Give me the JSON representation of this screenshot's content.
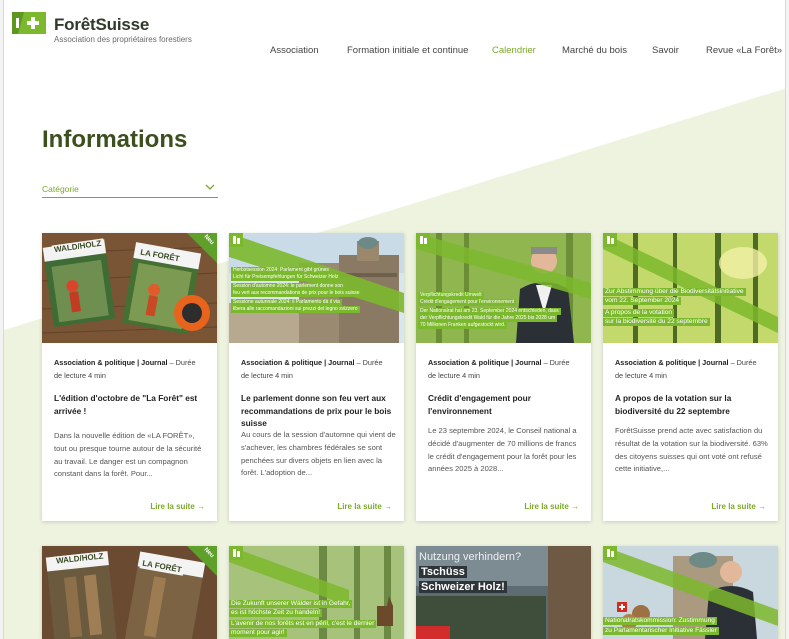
{
  "brand": {
    "name": "ForêtSuisse",
    "tagline": "Association des propriétaires forestiers"
  },
  "nav": [
    {
      "label": "Association",
      "active": false
    },
    {
      "label": "Formation initiale et continue",
      "active": false
    },
    {
      "label": "Calendrier",
      "active": true
    },
    {
      "label": "Marché du bois",
      "active": false
    },
    {
      "label": "Savoir",
      "active": false
    },
    {
      "label": "Revue «La Forêt»",
      "active": false
    }
  ],
  "page_title": "Informations",
  "filter": {
    "label": "Catégorie"
  },
  "colors": {
    "accent": "#7ba928",
    "title": "#3d4f1e",
    "wedge": "#eef3df"
  },
  "cards": [
    {
      "category": "Association & politique | Journal",
      "read_time": " – Durée de lecture 4 min",
      "title": "L'édition d'octobre de \"La Forêt\" est arrivée !",
      "excerpt": "Dans la nouvelle édition de «LA FORÊT», tout ou presque tourne autour de la sécurité au travail. Le danger est un compagnon constant dans la forêt. Pour...",
      "read_more": "Lire la suite →",
      "image": {
        "magazine_left": "WALD/HOLZ",
        "magazine_right": "LA FORÊT",
        "corner_label": "Neu"
      }
    },
    {
      "category": "Association & politique | Journal",
      "read_time": " – Durée de lecture 4 min",
      "title": "Le parlement donne son feu vert aux recommandations de prix pour le bois suisse",
      "excerpt": "Au cours de la session d'automne qui vient de s'achever, les chambres fédérales se sont penchées sur divers objets en lien avec la forêt. L'adoption de...",
      "read_more": "Lire la suite →",
      "image": {
        "strips": [
          "Herbstsession 2024: Parlament gibt grünes",
          "Licht für Preisempfehlungen für Schweizer Holz",
          "Session d'automne 2024: le parlement donne son",
          "feu vert aux recommandations de prix pour le bois suisse",
          "Sessione autunnale 2024: il Parlamento dà il via",
          "libera alle raccomandazioni sui prezzi del legno svizzero"
        ]
      }
    },
    {
      "category": "Association & politique | Journal",
      "read_time": " – Durée de lecture 4 min",
      "title": "Crédit d'engagement pour l'environnement",
      "excerpt": "Le 23 septembre 2024, le Conseil national a décidé d'augmenter de 70 millions de francs le crédit d'engagement pour la forêt pour les années 2025 à 2028...",
      "read_more": "Lire la suite →",
      "image": {
        "strips": [
          "Verpflichtungskredit Umwelt",
          "Crédit d'engagement pour l'environnement",
          "Der Nationalrat hat am 23. September 2024 entschieden, dass",
          "der Verpflichtungskredit Wald für die Jahre 2025 bis 2028 um",
          "70 Millionen Franken aufgestockt wird."
        ]
      }
    },
    {
      "category": "Association & politique | Journal",
      "read_time": " – Durée de lecture 4 min",
      "title": "A propos de la votation sur la biodiversité du 22 septembre",
      "excerpt": "ForêtSuisse prend acte avec satisfaction du résultat de la votation sur la biodiversité. 63% des citoyens suisses qui ont voté ont refusé cette initiative,...",
      "read_more": "Lire la suite →",
      "image": {
        "strips": [
          "Zur Abstimmung über die Biodiversitätsinitiative",
          "vom 22. September 2024",
          "A propos de la votation",
          "sur la biodiversité du 22 septembre"
        ]
      }
    }
  ],
  "bottom_cards": [
    {
      "image": {
        "magazine_left": "WALD/HOLZ",
        "magazine_right": "LA FORÊT",
        "corner_label": "Neu"
      }
    },
    {
      "image": {
        "strips": [
          "Die Zukunft unserer Wälder ist in Gefahr,",
          "es ist höchste Zeit zu handeln!",
          "L'avenir de nos forêts est en péril, c'est le dernier",
          "moment pour agir!"
        ]
      }
    },
    {
      "image": {
        "headline": "Nutzung verhindern?",
        "strip_1": "Tschüss",
        "strip_2": "Schweizer Holz!"
      }
    },
    {
      "image": {
        "strips": [
          "Nationalratskommission: Zustimmung",
          "zu Parlamentarischer Initiative Fässler"
        ]
      }
    }
  ]
}
